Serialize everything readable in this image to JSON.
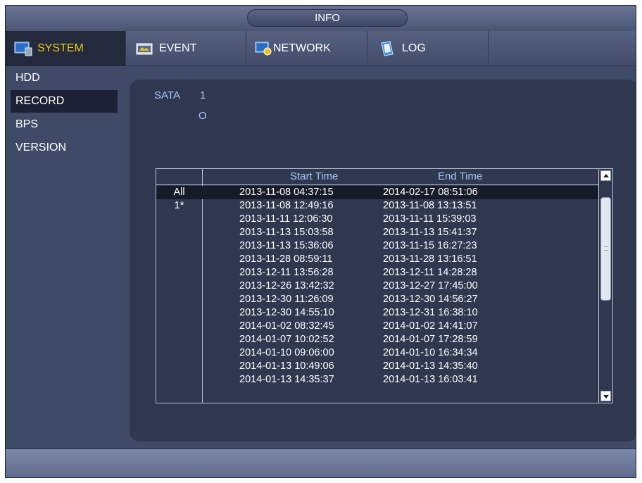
{
  "window": {
    "title": "INFO"
  },
  "tabs": [
    {
      "label": "SYSTEM",
      "icon": "monitor-icon"
    },
    {
      "label": "EVENT",
      "icon": "event-icon"
    },
    {
      "label": "NETWORK",
      "icon": "network-icon"
    },
    {
      "label": "LOG",
      "icon": "log-book-icon"
    }
  ],
  "sidebar": {
    "items": [
      {
        "label": "HDD"
      },
      {
        "label": "RECORD"
      },
      {
        "label": "BPS"
      },
      {
        "label": "VERSION"
      }
    ]
  },
  "record": {
    "sata_label": "SATA",
    "sata_number": "1",
    "sata_status": "O",
    "table": {
      "headers": {
        "id": "",
        "start": "Start Time",
        "end": "End Time"
      },
      "rows": [
        {
          "id": "All",
          "start": "2013-11-08 04:37:15",
          "end": "2014-02-17 08:51:06"
        },
        {
          "id": "1*",
          "start": "2013-11-08 12:49:16",
          "end": "2013-11-08 13:13:51"
        },
        {
          "id": "",
          "start": "2013-11-11 12:06:30",
          "end": "2013-11-11 15:39:03"
        },
        {
          "id": "",
          "start": "2013-11-13 15:03:58",
          "end": "2013-11-13 15:41:37"
        },
        {
          "id": "",
          "start": "2013-11-13 15:36:06",
          "end": "2013-11-15 16:27:23"
        },
        {
          "id": "",
          "start": "2013-11-28 08:59:11",
          "end": "2013-11-28 13:16:51"
        },
        {
          "id": "",
          "start": "2013-12-11 13:56:28",
          "end": "2013-12-11 14:28:28"
        },
        {
          "id": "",
          "start": "2013-12-26 13:42:32",
          "end": "2013-12-27 17:45:00"
        },
        {
          "id": "",
          "start": "2013-12-30 11:26:09",
          "end": "2013-12-30 14:56:27"
        },
        {
          "id": "",
          "start": "2013-12-30 14:55:10",
          "end": "2013-12-31 16:38:10"
        },
        {
          "id": "",
          "start": "2014-01-02 08:32:45",
          "end": "2014-01-02 14:41:07"
        },
        {
          "id": "",
          "start": "2014-01-07 10:02:52",
          "end": "2014-01-07 17:28:59"
        },
        {
          "id": "",
          "start": "2014-01-10 09:06:00",
          "end": "2014-01-10 16:34:34"
        },
        {
          "id": "",
          "start": "2014-01-13 10:49:06",
          "end": "2014-01-13 14:35:40"
        },
        {
          "id": "",
          "start": "2014-01-13 14:35:37",
          "end": "2014-01-13 16:03:41"
        }
      ]
    }
  },
  "colors": {
    "accent_active_tab": "#f0c419",
    "header_text": "#a9c8ff",
    "background": "#3f4a67"
  }
}
